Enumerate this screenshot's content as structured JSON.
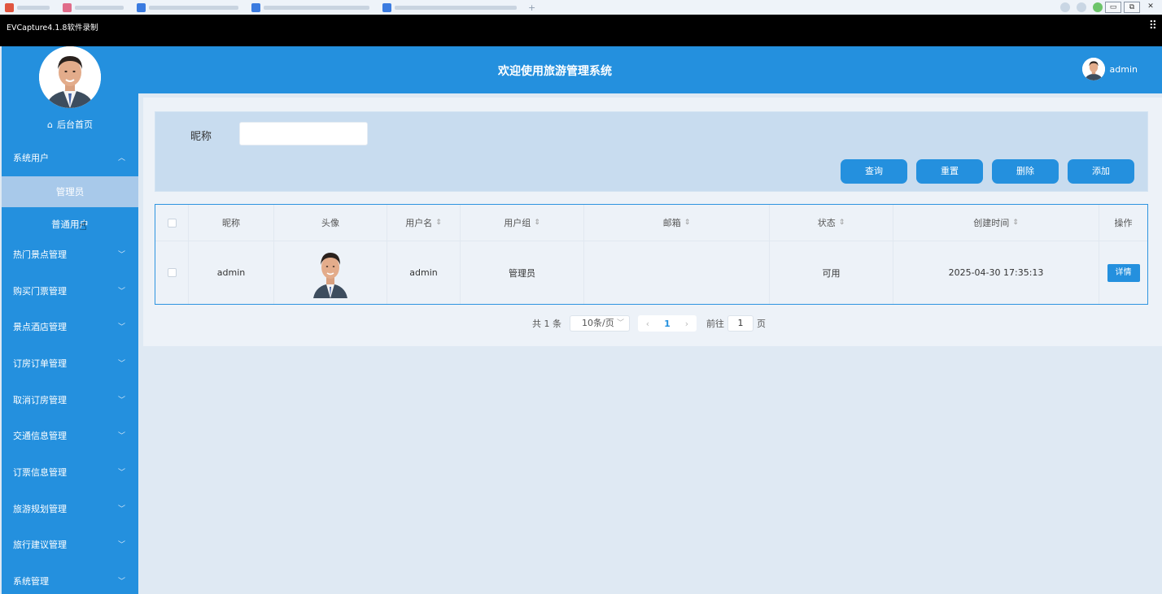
{
  "recorder": {
    "title": "EVCapture4.1.8软件录制"
  },
  "window_controls": {
    "minimize": "▭",
    "restore": "⧉",
    "close": "✕"
  },
  "sidebar": {
    "home_label": "后台首页",
    "group_system_user": "系统用户",
    "sub_items": [
      "管理员",
      "普通用户"
    ],
    "menu": [
      "热门景点管理",
      "购买门票管理",
      "景点酒店管理",
      "订房订单管理",
      "取消订房管理",
      "交通信息管理",
      "订票信息管理",
      "旅游规划管理",
      "旅行建议管理",
      "系统管理"
    ]
  },
  "header": {
    "title": "欢迎使用旅游管理系统",
    "username": "admin"
  },
  "search": {
    "label": "昵称",
    "value": "",
    "buttons": {
      "query": "查询",
      "reset": "重置",
      "delete": "删除",
      "add": "添加"
    }
  },
  "table": {
    "headers": [
      "昵称",
      "头像",
      "用户名",
      "用户组",
      "邮箱",
      "状态",
      "创建时间",
      "操作"
    ],
    "rows": [
      {
        "nickname": "admin",
        "username": "admin",
        "group": "管理员",
        "email": "",
        "status": "可用",
        "created": "2025-04-30 17:35:13",
        "action": "详情"
      }
    ]
  },
  "pagination": {
    "total": "共 1 条",
    "page_size": "10条/页",
    "current_page": "1",
    "goto_prefix": "前往",
    "goto_value": "1",
    "goto_suffix": "页"
  },
  "colors": {
    "primary": "#2490de",
    "background": "#dfe9f3",
    "active_sub": "#a8c9ea"
  }
}
